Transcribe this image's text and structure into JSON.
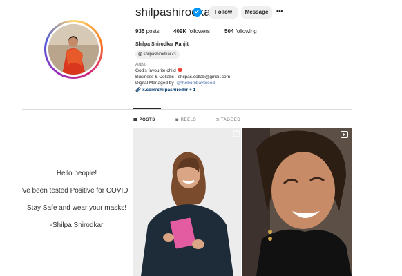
{
  "profile": {
    "username": "shilpashirodkar73",
    "verified_glyph": "✔",
    "follow_label": "Follow",
    "message_label": "Message",
    "more_glyph": "•••",
    "posts_count": "935",
    "posts_label": "posts",
    "followers_count": "409K",
    "followers_label": "followers",
    "following_count": "504",
    "following_label": "following",
    "full_name": "Shilpa Shirodkar Ranjit",
    "threads_handle": "shilpashirodkar73",
    "category": "Artist",
    "bio_line1": "God's favourite child",
    "heart": "❤️",
    "bio_line2": "Business & Collabs - shilpas.collab@gmail.com",
    "bio_line3_prefix": "Digital Managed by- ",
    "bio_line3_mention": "@thebombaybreed",
    "link_text": "x.com/Shilpashirodkr",
    "link_more": "+ 1"
  },
  "tabs": [
    {
      "label": "POSTS",
      "icon": "grid-icon"
    },
    {
      "label": "REELS",
      "icon": "reels-icon"
    },
    {
      "label": "TAGGED",
      "icon": "tagged-icon"
    }
  ],
  "posts": {
    "text_post_lines": [
      "Hello people!",
      "I've been tested Positive for COVID",
      "Stay Safe and wear your masks!",
      "-Shilpa Shirodkar"
    ]
  },
  "colors": {
    "accent_blue": "#0095f6",
    "link_blue": "#00376b",
    "button_gray": "#efefef",
    "divider": "#dbdbdb"
  }
}
